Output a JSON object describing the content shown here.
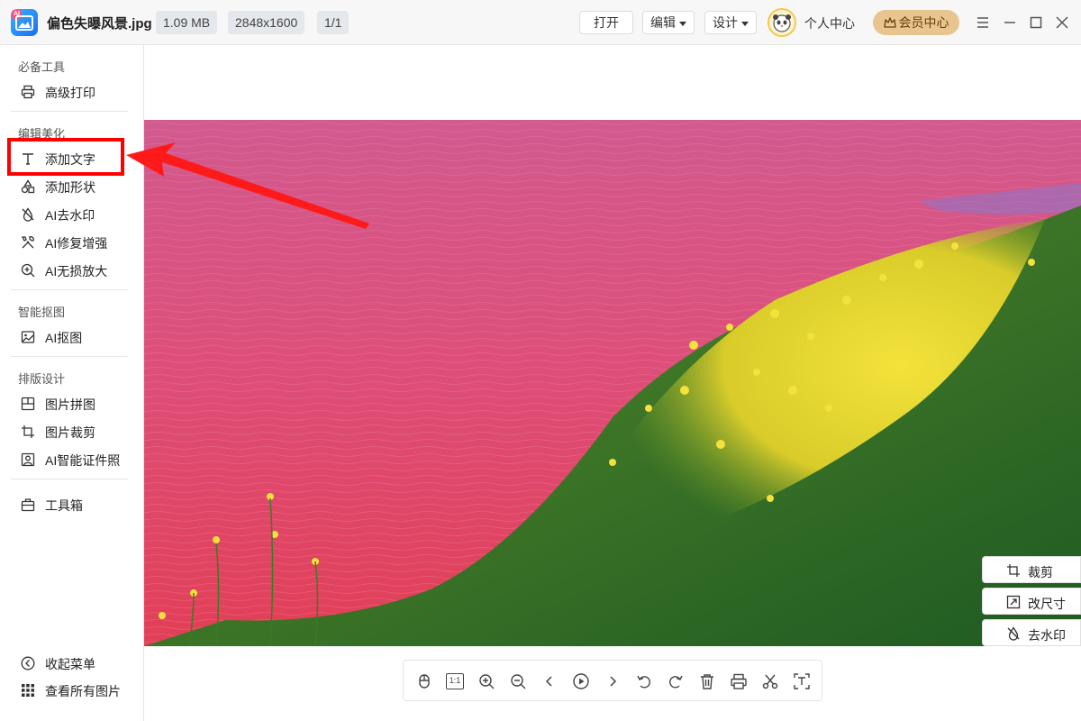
{
  "header": {
    "file_name": "偏色失曝风景.jpg",
    "file_size": "1.09 MB",
    "dimensions": "2848x1600",
    "page_count": "1/1",
    "open_label": "打开",
    "edit_label": "编辑",
    "design_label": "设计",
    "user_center_label": "个人中心",
    "vip_label": "会员中心",
    "logo_tag": "AI"
  },
  "sidebar": {
    "sections": [
      {
        "title": "必备工具",
        "items": [
          {
            "label": "高级打印",
            "icon": "printer-icon"
          }
        ]
      },
      {
        "title": "编辑美化",
        "items": [
          {
            "label": "添加文字",
            "icon": "text-icon"
          },
          {
            "label": "添加形状",
            "icon": "shapes-icon"
          },
          {
            "label": "AI去水印",
            "icon": "drop-slash-icon"
          },
          {
            "label": "AI修复增强",
            "icon": "tools-icon"
          },
          {
            "label": "AI无损放大",
            "icon": "zoom-plus-icon"
          }
        ]
      },
      {
        "title": "智能抠图",
        "items": [
          {
            "label": "AI抠图",
            "icon": "image-icon"
          }
        ]
      },
      {
        "title": "排版设计",
        "items": [
          {
            "label": "图片拼图",
            "icon": "collage-icon"
          },
          {
            "label": "图片裁剪",
            "icon": "crop-icon"
          },
          {
            "label": "AI智能证件照",
            "icon": "id-photo-icon"
          }
        ]
      }
    ],
    "toolbox_label": "工具箱",
    "collapse_label": "收起菜单",
    "view_all_label": "查看所有图片"
  },
  "float_actions": {
    "crop_label": "裁剪",
    "resize_label": "改尺寸",
    "watermark_label": "去水印"
  },
  "bottom_toolbar": {
    "actual_size_label": "1:1",
    "icons": [
      "mouse-icon",
      "actual-size-icon",
      "zoom-in-icon",
      "zoom-out-icon",
      "prev-icon",
      "play-icon",
      "next-icon",
      "rotate-left-icon",
      "rotate-right-icon",
      "delete-icon",
      "print-icon",
      "cut-icon",
      "text-recognize-icon"
    ]
  },
  "colors": {
    "highlight": "#ff0000",
    "vip": "#e8c58e",
    "accent": "#1e6cf0"
  }
}
